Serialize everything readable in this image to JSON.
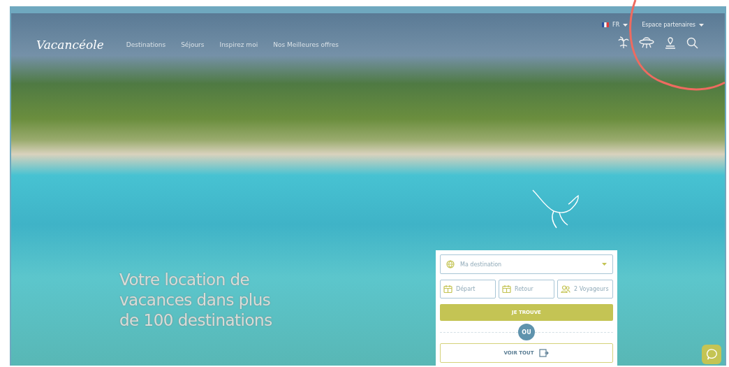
{
  "header": {
    "logo": "Vacancéole",
    "nav": [
      {
        "label": "Destinations"
      },
      {
        "label": "Séjours"
      },
      {
        "label": "Inspirez moi"
      },
      {
        "label": "Nos Meilleures offres"
      }
    ],
    "language": "FR",
    "partner_menu": "Espace partenaires"
  },
  "hero": {
    "headline": "Votre location de vacances dans plus de 100 destinations"
  },
  "search": {
    "destination": {
      "placeholder": "Ma destination"
    },
    "departure": {
      "placeholder": "Départ"
    },
    "return": {
      "placeholder": "Retour"
    },
    "travellers": {
      "value": "2 Voyageurs"
    },
    "submit": "JE TROUVE",
    "separator": "OU",
    "see_all": "VOIR TOUT"
  }
}
